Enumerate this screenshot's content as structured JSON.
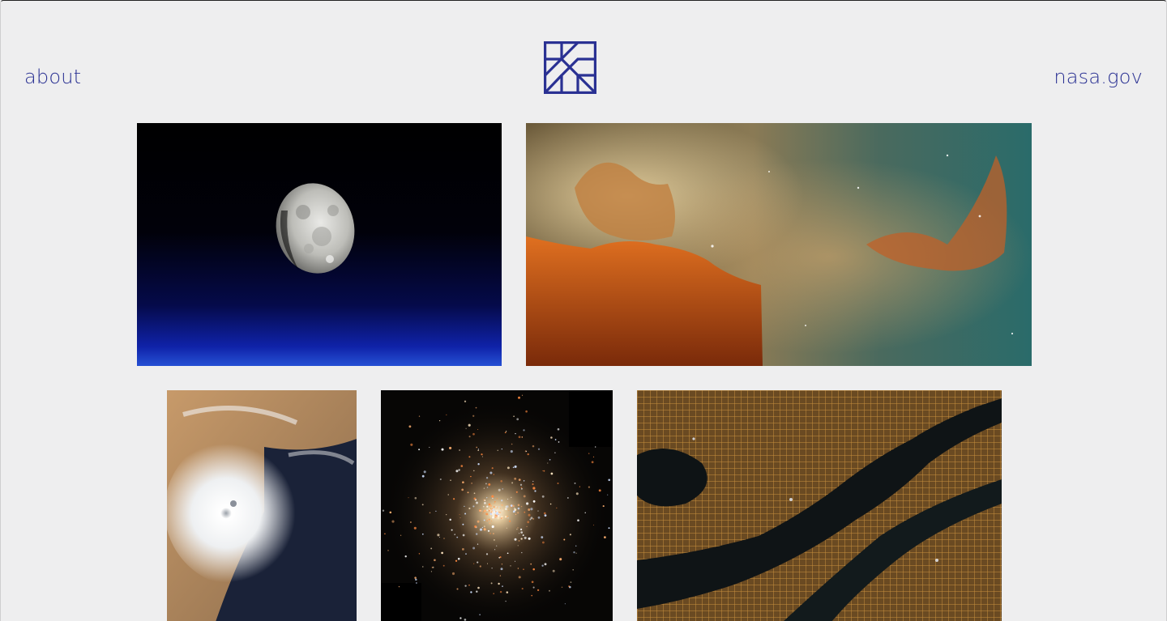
{
  "header": {
    "about_label": "about",
    "nasa_label": "nasa.gov",
    "logo_icon": "nasa-image-gallery-logo-icon"
  },
  "colors": {
    "background": "#eeeeef",
    "accent": "#2a3193"
  },
  "gallery": {
    "images": [
      {
        "name": "moon-photo"
      },
      {
        "name": "carina-nebula-photo"
      },
      {
        "name": "hurricane-photo"
      },
      {
        "name": "globular-cluster-photo"
      },
      {
        "name": "city-lights-photo"
      }
    ]
  }
}
